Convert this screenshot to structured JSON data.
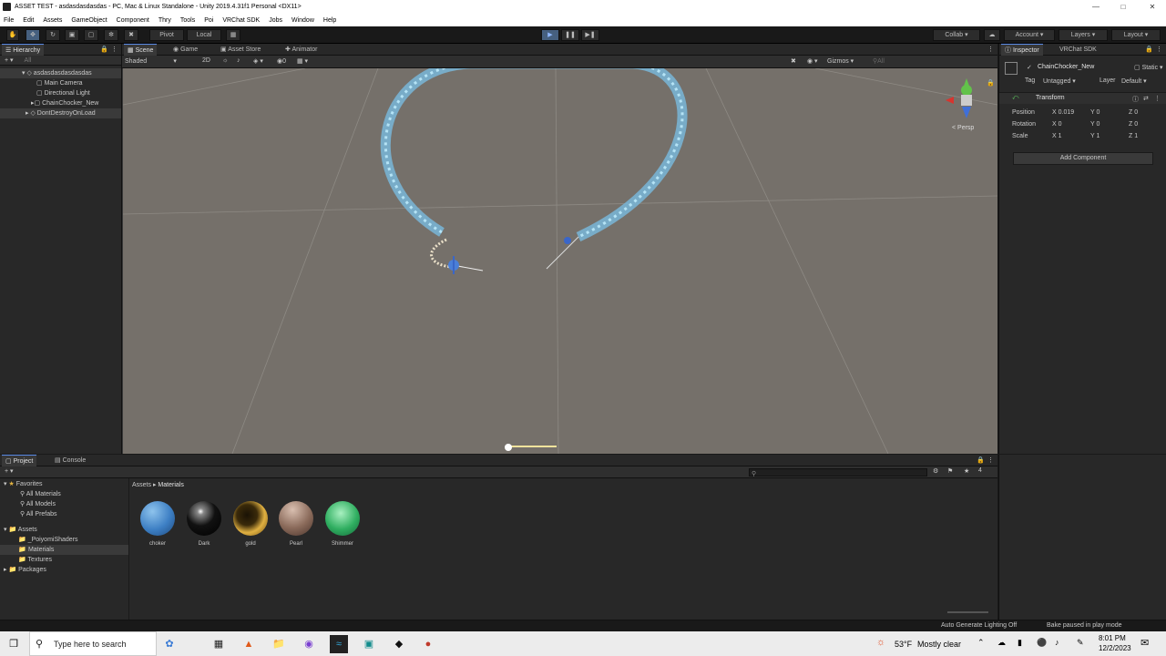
{
  "window": {
    "title": "ASSET TEST - asdasdasdasdas - PC, Mac & Linux Standalone - Unity 2019.4.31f1 Personal <DX11>"
  },
  "menu": [
    "File",
    "Edit",
    "Assets",
    "GameObject",
    "Component",
    "Thry",
    "Tools",
    "Poi",
    "VRChat SDK",
    "Jobs",
    "Window",
    "Help"
  ],
  "toolbar": {
    "pivot": "Pivot",
    "local": "Local",
    "collab": "Collab",
    "account": "Account",
    "layers": "Layers",
    "layout": "Layout"
  },
  "hierarchy": {
    "tab": "Hierarchy",
    "search_placeholder": "All",
    "scene": "asdasdasdasdasdas",
    "items": [
      "Main Camera",
      "Directional Light",
      "ChainChocker_New"
    ],
    "dontdestroy": "DontDestroyOnLoad"
  },
  "scene_tabs": {
    "scene": "Scene",
    "game": "Game",
    "asset_store": "Asset Store",
    "animator": "Animator"
  },
  "scene_toolbar": {
    "shaded": "Shaded",
    "mode2d": "2D",
    "gizmos": "Gizmos",
    "search_placeholder": "All",
    "persp": "< Persp"
  },
  "inspector": {
    "tab1": "Inspector",
    "tab2": "VRChat SDK",
    "object_name": "ChainChocker_New",
    "static": "Static",
    "tag_label": "Tag",
    "tag_value": "Untagged",
    "layer_label": "Layer",
    "layer_value": "Default",
    "component": "Transform",
    "position_label": "Position",
    "rotation_label": "Rotation",
    "scale_label": "Scale",
    "position": {
      "x": "0.019",
      "y": "0",
      "z": "0"
    },
    "rotation": {
      "x": "0",
      "y": "0",
      "z": "0"
    },
    "scale": {
      "x": "1",
      "y": "1",
      "z": "1"
    },
    "axis_x": "X",
    "axis_y": "Y",
    "axis_z": "Z",
    "add_component": "Add Component"
  },
  "project": {
    "tab_project": "Project",
    "tab_console": "Console",
    "favorites": "Favorites",
    "fav_items": [
      "All Materials",
      "All Models",
      "All Prefabs"
    ],
    "assets": "Assets",
    "asset_folders": [
      "_PoiyomiShaders",
      "Materials",
      "Textures"
    ],
    "packages": "Packages",
    "breadcrumb_root": "Assets",
    "breadcrumb_current": "Materials",
    "count": "4",
    "materials": [
      {
        "name": "choker",
        "color": "#3d7fc4"
      },
      {
        "name": "Dark",
        "color": "#111111"
      },
      {
        "name": "gold",
        "color": "#b8862a"
      },
      {
        "name": "Pearl",
        "color": "#8a6a5a"
      },
      {
        "name": "Shimmer",
        "color": "#2fae60"
      }
    ]
  },
  "status": {
    "lighting": "Auto Generate Lighting Off",
    "bake": "Bake paused in play mode"
  },
  "taskbar": {
    "search_placeholder": "Type here to search",
    "weather_temp": "53°F",
    "weather_desc": "Mostly clear",
    "time": "8:01 PM",
    "date": "12/2/2023"
  }
}
